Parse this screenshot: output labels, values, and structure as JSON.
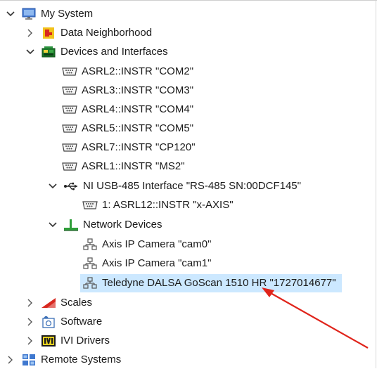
{
  "tree": {
    "root_label": "My System",
    "data_neighborhood": "Data Neighborhood",
    "devices_and_interfaces": "Devices and Interfaces",
    "serial_ports": [
      "ASRL2::INSTR \"COM2\"",
      "ASRL3::INSTR \"COM3\"",
      "ASRL4::INSTR \"COM4\"",
      "ASRL5::INSTR \"COM5\"",
      "ASRL7::INSTR \"CP120\"",
      "ASRL1::INSTR \"MS2\""
    ],
    "usb_interface": "NI USB-485 Interface \"RS-485 SN:00DCF145\"",
    "usb_child": "1: ASRL12::INSTR \"x-AXIS\"",
    "network_devices": "Network Devices",
    "network_items": [
      "Axis IP Camera \"cam0\"",
      "Axis IP Camera \"cam1\"",
      "Teledyne DALSA GoScan 1510 HR \"1727014677\""
    ],
    "scales": "Scales",
    "software": "Software",
    "ivi_drivers": "IVI Drivers",
    "remote_systems": "Remote Systems"
  },
  "icons": {
    "computer": "computer-icon",
    "data_neighborhood": "data-neighborhood-icon",
    "devices": "devices-interfaces-icon",
    "serial": "serial-port-icon",
    "usb": "usb-icon",
    "network": "network-devices-icon",
    "camera": "network-node-icon",
    "scales": "scales-icon",
    "software": "software-icon",
    "ivi": "ivi-drivers-icon",
    "remote": "remote-systems-icon"
  },
  "colors": {
    "selection": "#cce8ff",
    "arrow": "#e0241b"
  }
}
